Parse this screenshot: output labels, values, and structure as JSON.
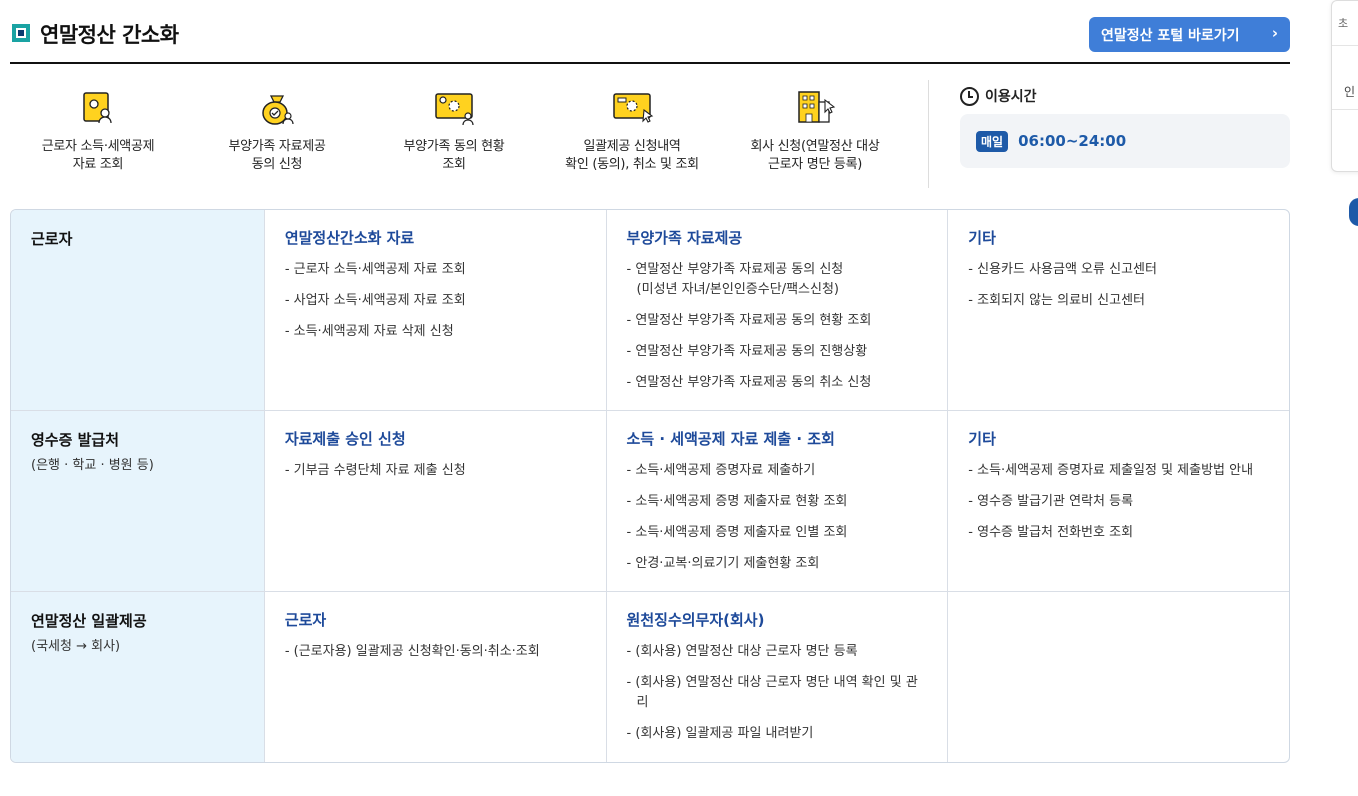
{
  "header": {
    "title": "연말정산 간소화",
    "portal_button": "연말정산 포털 바로가기",
    "chevron": "›"
  },
  "quick_menu": [
    {
      "label": "근로자 소득·세액공제\n자료 조회",
      "icon": "document-person-icon"
    },
    {
      "label": "부양가족 자료제공\n동의 신청",
      "icon": "money-bag-icon"
    },
    {
      "label": "부양가족 동의 현황\n조회",
      "icon": "monitor-family-icon"
    },
    {
      "label": "일괄제공 신청내역\n확인 (동의), 취소 및 조회",
      "icon": "monitor-cursor-icon"
    },
    {
      "label": "회사 신청(연말정산 대상\n근로자 명단 등록)",
      "icon": "building-icon"
    }
  ],
  "usage": {
    "title": "이용시간",
    "badge": "매일",
    "hours": "06:00~24:00"
  },
  "rows": [
    {
      "head": "근로자",
      "sub": "",
      "cells": [
        {
          "title": "연말정산간소화 자료",
          "items": [
            "근로자 소득·세액공제 자료 조회",
            "사업자 소득·세액공제 자료 조회",
            "소득·세액공제 자료 삭제 신청"
          ]
        },
        {
          "title": "부양가족 자료제공",
          "items": [
            "연말정산 부양가족 자료제공 동의 신청\n(미성년 자녀/본인인증수단/팩스신청)",
            "연말정산 부양가족 자료제공 동의 현황 조회",
            "연말정산 부양가족 자료제공 동의 진행상황",
            "연말정산 부양가족 자료제공 동의 취소 신청"
          ]
        },
        {
          "title": "기타",
          "items": [
            "신용카드 사용금액 오류 신고센터",
            "조회되지 않는 의료비 신고센터"
          ]
        }
      ]
    },
    {
      "head": "영수증 발급처",
      "sub": "(은행 · 학교 · 병원 등)",
      "cells": [
        {
          "title": "자료제출 승인 신청",
          "items": [
            "기부금 수령단체 자료 제출 신청"
          ]
        },
        {
          "title": "소득 · 세액공제 자료 제출 · 조회",
          "items": [
            "소득·세액공제 증명자료 제출하기",
            "소득·세액공제 증명 제출자료 현황 조회",
            "소득·세액공제 증명 제출자료 인별 조회",
            "안경·교복·의료기기 제출현황 조회"
          ]
        },
        {
          "title": "기타",
          "items": [
            "소득·세액공제 증명자료 제출일정 및 제출방법 안내",
            "영수증 발급기관 연락처 등록",
            "영수증 발급처 전화번호 조회"
          ]
        }
      ]
    },
    {
      "head": "연말정산 일괄제공",
      "sub": "(국세청 → 회사)",
      "cells": [
        {
          "title": "근로자",
          "items": [
            "(근로자용) 일괄제공 신청확인·동의·취소·조회"
          ]
        },
        {
          "title": "원천징수의무자(회사)",
          "items": [
            "(회사용) 연말정산 대상 근로자 명단 등록",
            "(회사용) 연말정산 대상 근로자 명단 내역 확인 및 관리",
            "(회사용) 일괄제공 파일 내려받기"
          ]
        },
        {
          "title": "",
          "items": []
        }
      ]
    }
  ],
  "side_panel": {
    "label1": "초",
    "label2": "인"
  },
  "colors": {
    "accent": "#3f7ed8",
    "link_title": "#1e4a9a",
    "row_head_bg": "#e7f4fc",
    "icon_yellow": "#ffd21f"
  }
}
